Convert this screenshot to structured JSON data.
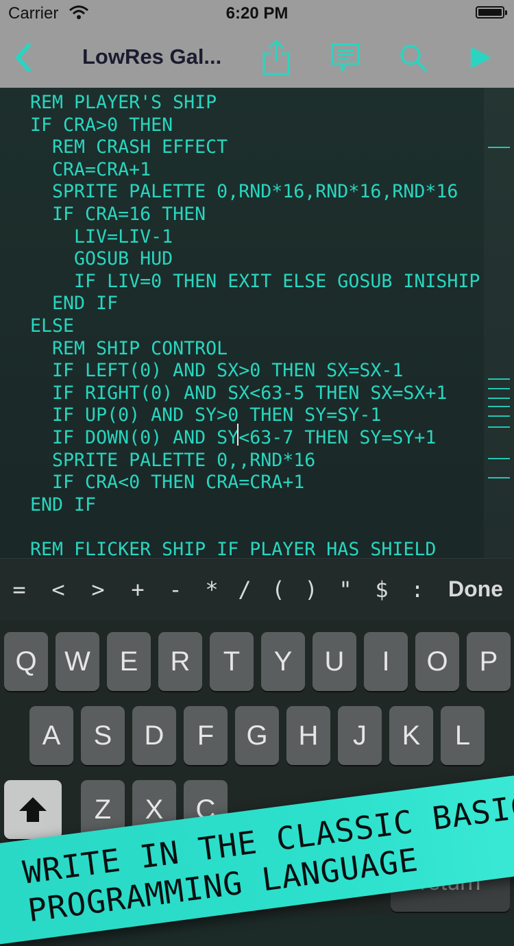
{
  "status_bar": {
    "carrier": "Carrier",
    "time": "6:20 PM"
  },
  "nav": {
    "title": "LowRes Gal...",
    "accent": "#2bd4c0",
    "icons": [
      "back-icon",
      "share-icon",
      "comment-icon",
      "search-icon",
      "play-icon"
    ]
  },
  "editor": {
    "text_color": "#29d6c0",
    "lines": [
      "REM PLAYER'S SHIP",
      "IF CRA>0 THEN",
      "  REM CRASH EFFECT",
      "  CRA=CRA+1",
      "  SPRITE PALETTE 0,RND*16,RND*16,RND*16",
      "  IF CRA=16 THEN",
      "    LIV=LIV-1",
      "    GOSUB HUD",
      "    IF LIV=0 THEN EXIT ELSE GOSUB INISHIP",
      "  END IF",
      "ELSE",
      "  REM SHIP CONTROL",
      "  IF LEFT(0) AND SX>0 THEN SX=SX-1",
      "  IF RIGHT(0) AND SX<63-5 THEN SX=SX+1",
      "  IF UP(0) AND SY>0 THEN SY=SY-1",
      "  IF DOWN(0) AND SY<63-7 THEN SY=SY+1",
      "  SPRITE PALETTE 0,,RND*16",
      "  IF CRA<0 THEN CRA=CRA+1",
      "END IF",
      "",
      "REM FLICKER SHIP IF PLAYER HAS SHIELD"
    ]
  },
  "accessory": {
    "keys": [
      "=",
      "<",
      ">",
      "+",
      "-",
      "*",
      "/",
      "(",
      ")",
      "\"",
      "$",
      ":"
    ],
    "done": "Done"
  },
  "keyboard": {
    "row1": [
      "Q",
      "W",
      "E",
      "R",
      "T",
      "Y",
      "U",
      "I",
      "O",
      "P"
    ],
    "row2": [
      "A",
      "S",
      "D",
      "F",
      "G",
      "H",
      "J",
      "K",
      "L"
    ],
    "row3_visible": [
      "Z",
      "X",
      "C"
    ],
    "return_label": "return"
  },
  "banner": {
    "line1": "WRITE IN THE CLASSIC BASIC",
    "line2": "PROGRAMMING LANGUAGE",
    "color": "#2ad9c6"
  }
}
